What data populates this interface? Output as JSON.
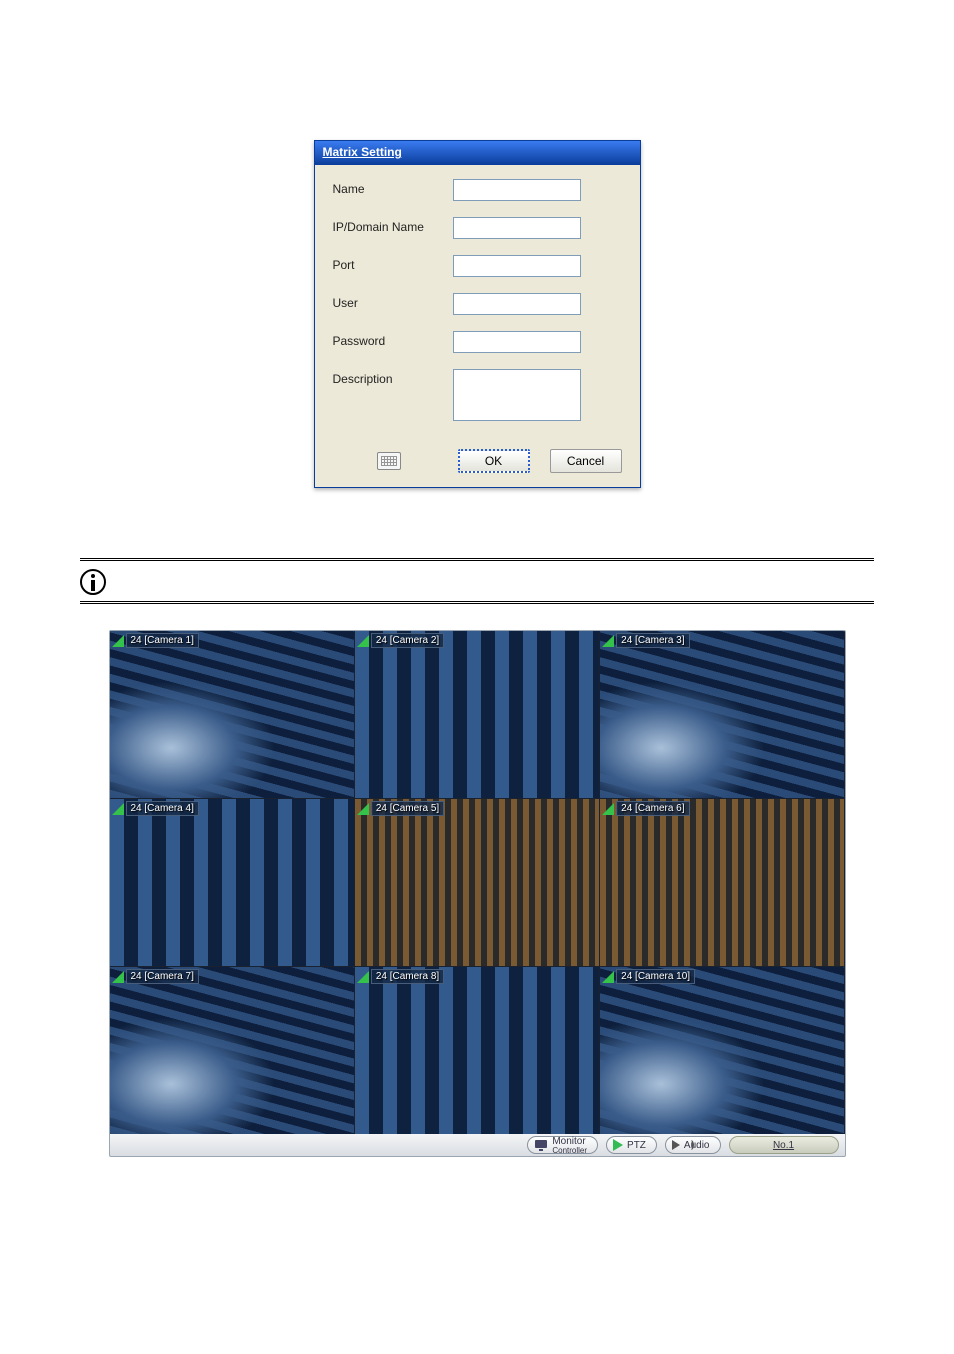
{
  "dialog": {
    "title": "Matrix Setting",
    "fields": {
      "name": {
        "label": "Name",
        "value": ""
      },
      "ipdomain": {
        "label": "IP/Domain Name",
        "value": ""
      },
      "port": {
        "label": "Port",
        "value": ""
      },
      "user": {
        "label": "User",
        "value": ""
      },
      "password": {
        "label": "Password",
        "value": ""
      },
      "description": {
        "label": "Description",
        "value": ""
      }
    },
    "buttons": {
      "ok": "OK",
      "cancel": "Cancel"
    },
    "keyboard_icon": "keyboard-icon"
  },
  "info_icon": "info-icon",
  "camera_grid": {
    "cells": [
      {
        "label": "24 [Camera 1]",
        "scene": "control-room"
      },
      {
        "label": "24 [Camera 2]",
        "scene": "control-room2"
      },
      {
        "label": "24 [Camera 3]",
        "scene": "control-room"
      },
      {
        "label": "24 [Camera 4]",
        "scene": "control-room2"
      },
      {
        "label": "24 [Camera 5]",
        "scene": "store"
      },
      {
        "label": "24 [Camera 6]",
        "scene": "store"
      },
      {
        "label": "24 [Camera 7]",
        "scene": "control-room"
      },
      {
        "label": "24 [Camera 8]",
        "scene": "control-room2"
      },
      {
        "label": "24 [Camera 10]",
        "scene": "control-room"
      }
    ]
  },
  "toolbar": {
    "monitor_controller": {
      "top": "Monitor",
      "bottom": "Controller"
    },
    "ptz": "PTZ",
    "audio": "Audio",
    "slot": "No.1"
  }
}
